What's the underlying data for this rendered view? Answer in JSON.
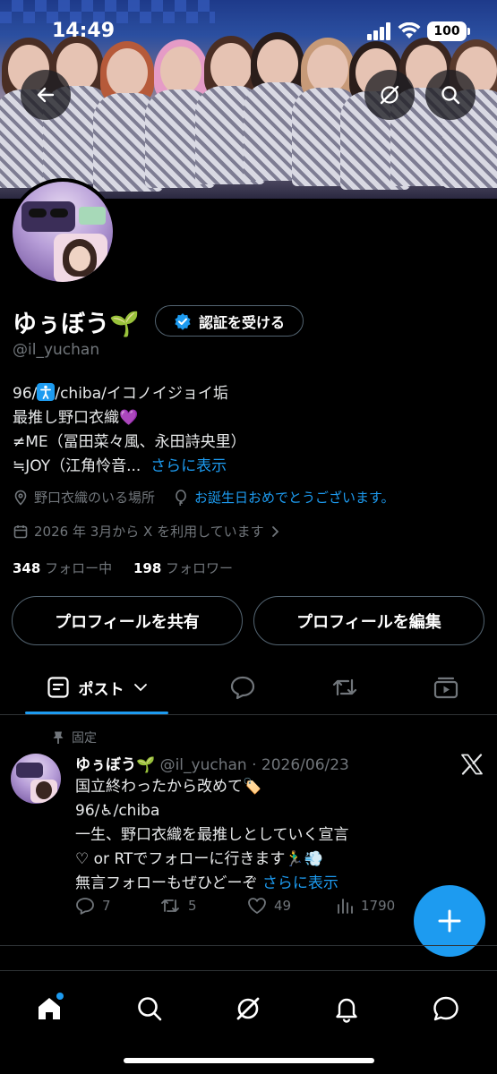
{
  "status_bar": {
    "time": "14:49",
    "battery": "100"
  },
  "profile": {
    "name": "ゆぅぼう🌱",
    "handle": "@il_yuchan",
    "verify_label": "認証を受ける",
    "bio_lines": [
      {
        "prefix": "96/",
        "icon": "accessibility-icon",
        "suffix": "/chiba/イコノイジョイ垢"
      },
      {
        "text": "最推し野口衣織💜"
      },
      {
        "text": "≠ME（冨田菜々風、永田詩央里）"
      },
      {
        "text": "≒JOY（江角怜音...",
        "more": "さらに表示"
      }
    ],
    "location": "野口衣織のいる場所",
    "birthday_text": "お誕生日おめでとうございます。",
    "joined": "2026 年 3月から X を利用しています",
    "following_count": "348",
    "following_label": "フォロー中",
    "followers_count": "198",
    "followers_label": "フォロワー",
    "share_button": "プロフィールを共有",
    "edit_button": "プロフィールを編集"
  },
  "tabs": {
    "posts_label": "ポスト",
    "selected": "posts"
  },
  "pinned_post": {
    "pinned_label": "固定",
    "author": "ゆぅぼう🌱",
    "handle_date": "@il_yuchan · 2026/06/23",
    "lines": [
      "国立終わったから改めて🏷️",
      "96/♿/chiba",
      "一生、野口衣織を最推しとしていく宣言",
      "♡ or RTでフォローに行きます🏃‍♂️💨"
    ],
    "last_line": "無言フォローもぜひどーぞ",
    "more": "さらに表示",
    "replies": "7",
    "reposts": "5",
    "likes": "49",
    "views": "1790"
  },
  "colors": {
    "accent": "#1d9bf0",
    "secondary_text": "#71767b",
    "border": "#536471"
  }
}
